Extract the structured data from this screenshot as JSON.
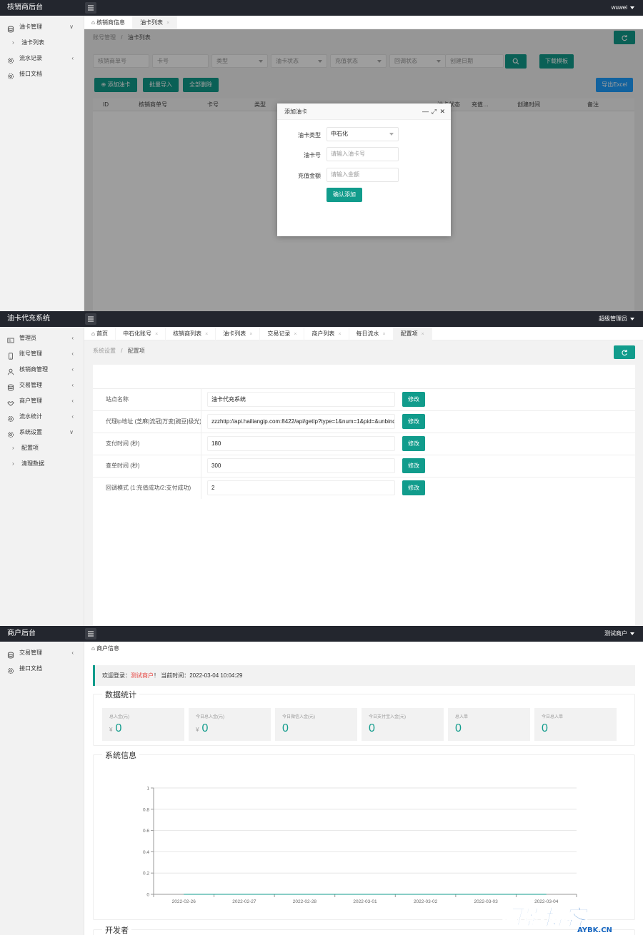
{
  "panel1": {
    "brand": "核销商后台",
    "user": "wuwei",
    "sidebar": [
      {
        "label": "油卡管理",
        "icon": "database-icon",
        "chev": "∨"
      },
      {
        "label": "油卡列表",
        "sub": true
      },
      {
        "label": "流水记录",
        "icon": "gear-icon",
        "chev": "‹"
      },
      {
        "label": "接口文档",
        "icon": "gear-icon"
      }
    ],
    "tabs": [
      {
        "label": "核销商信息",
        "home": true
      },
      {
        "label": "油卡列表",
        "active": true,
        "close": "×"
      }
    ],
    "breadcrumb": {
      "parent": "账号管理",
      "sep": "/",
      "current": "油卡列表"
    },
    "filters": {
      "order_no": "核销商单号",
      "card_no": "卡号",
      "type": "类型",
      "card_status": "油卡状态",
      "recharge_status": "充值状态",
      "callback_status": "回调状态",
      "created_date": "创建日期"
    },
    "buttons": {
      "download": "下载模板",
      "add": "添加油卡",
      "import": "批量导入",
      "delete_all": "全部删除",
      "export": "导出Excel"
    },
    "table_headers": [
      "ID",
      "核销商单号",
      "卡号",
      "类型",
      "油卡状态",
      "充值…",
      "创建时间",
      "备注"
    ],
    "modal": {
      "title": "添加油卡",
      "card_type_label": "油卡类型",
      "card_type_value": "中石化",
      "card_no_label": "油卡号",
      "card_no_placeholder": "请输入油卡号",
      "amount_label": "充值金额",
      "amount_placeholder": "请输入金额",
      "submit": "确认添加"
    }
  },
  "panel2": {
    "brand": "油卡代充系统",
    "user": "超级管理员",
    "sidebar": [
      {
        "label": "管理员",
        "icon": "id-card-icon",
        "chev": "‹"
      },
      {
        "label": "账号管理",
        "icon": "phone-icon",
        "chev": "‹"
      },
      {
        "label": "核销商管理",
        "icon": "user-icon",
        "chev": "‹"
      },
      {
        "label": "交易管理",
        "icon": "database-icon",
        "chev": "‹"
      },
      {
        "label": "商户管理",
        "icon": "handshake-icon",
        "chev": "‹"
      },
      {
        "label": "流水统计",
        "icon": "gear-icon",
        "chev": "‹"
      },
      {
        "label": "系统设置",
        "icon": "gear-icon",
        "chev": "∨"
      },
      {
        "label": "配置项",
        "sub": true
      },
      {
        "label": "清理数据",
        "sub": true
      }
    ],
    "tabs": [
      {
        "label": "首页",
        "home": true
      },
      {
        "label": "中石化账号",
        "close": "×"
      },
      {
        "label": "核销商列表",
        "close": "×"
      },
      {
        "label": "油卡列表",
        "close": "×"
      },
      {
        "label": "交易记录",
        "close": "×"
      },
      {
        "label": "商户列表",
        "close": "×"
      },
      {
        "label": "每日流水",
        "close": "×"
      },
      {
        "label": "配置项",
        "active": true,
        "close": "×"
      }
    ],
    "breadcrumb": {
      "parent": "系统设置",
      "sep": "/",
      "current": "配置项"
    },
    "config_rows": [
      {
        "label": "站点名称",
        "value": "油卡代充系统",
        "button": "修改"
      },
      {
        "label": "代理ip地址 (芝麻|流冠|万变|豌豆|极光)",
        "value": "zzzhttp://api.hailiangip.com:8422/api/getIp?type=1&num=1&pid=&unbindTime",
        "button": "修改"
      },
      {
        "label": "支付时间 (秒)",
        "value": "180",
        "button": "修改"
      },
      {
        "label": "查单时间 (秒)",
        "value": "300",
        "button": "修改"
      },
      {
        "label": "回调模式 (1:充值成功/2:支付成功)",
        "value": "2",
        "button": "修改"
      }
    ]
  },
  "panel3": {
    "brand": "商户后台",
    "user": "测试商户",
    "sidebar": [
      {
        "label": "交易管理",
        "icon": "database-icon",
        "chev": "‹"
      },
      {
        "label": "接口文档",
        "icon": "gear-icon"
      }
    ],
    "tab": "商户信息",
    "welcome": {
      "prefix": "欢迎登录：",
      "user": "测试商户",
      "suffix": "！ 当前时间：2022-03-04 10:04:29"
    },
    "stats_title": "数据统计",
    "stats": [
      {
        "label": "总入金(元)",
        "value": "0",
        "currency": "¥"
      },
      {
        "label": "今日总入金(元)",
        "value": "0",
        "currency": "¥"
      },
      {
        "label": "今日微信入金(元)",
        "value": "0"
      },
      {
        "label": "今日支付宝入金(元)",
        "value": "0"
      },
      {
        "label": "总入单",
        "value": "0"
      },
      {
        "label": "今日总入单",
        "value": "0"
      }
    ],
    "system_title": "系统信息",
    "developer_title": "开发者"
  },
  "chart_data": {
    "type": "line",
    "x": [
      "2022-02-26",
      "2022-02-27",
      "2022-02-28",
      "2022-03-01",
      "2022-03-02",
      "2022-03-03",
      "2022-03-04"
    ],
    "series": [
      {
        "values": [
          0,
          0,
          0,
          0,
          0,
          0,
          0
        ]
      }
    ],
    "ylim": [
      0,
      1
    ],
    "yticks": [
      "0",
      "0.2",
      "0.4",
      "0.6",
      "0.8",
      "1"
    ],
    "grid": true
  },
  "watermark": {
    "main": "阿影博客",
    "sub": "AYBK.CN"
  }
}
